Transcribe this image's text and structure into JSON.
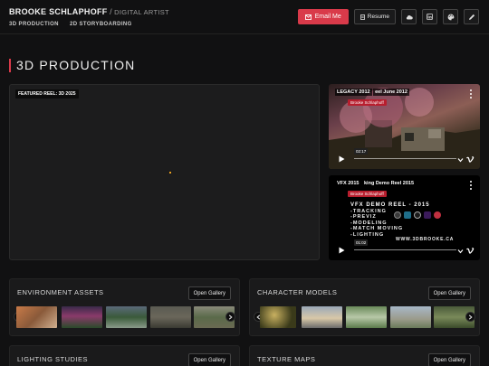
{
  "header": {
    "name": "BROOKE SCHLAPHOFF",
    "separator": "/",
    "role": "DIGITAL ARTIST",
    "nav": [
      "3D PRODUCTION",
      "2D STORYBOARDING"
    ],
    "email_label": "Email Me",
    "resume_label": "Resume",
    "icons": [
      "cloud-icon",
      "linkedin-icon",
      "palette-icon",
      "pencil-icon"
    ]
  },
  "section": {
    "title": "3D PRODUCTION",
    "accent": "#d93a4a"
  },
  "featured": {
    "label": "FEATURED REEL: 3D 2025"
  },
  "videos": [
    {
      "tag": "LEGACY 2012",
      "title": "eel June 2012",
      "byline": "Brooke Schlaphoff",
      "time": "02:17"
    },
    {
      "tag": "VFX 2015",
      "title": "king Demo Reel 2015",
      "byline": "Brooke Schlaphoff",
      "heading": "VFX DEMO REEL - 2015",
      "lines": [
        "-TRACKING",
        "-PREVIZ",
        "-MODELING",
        "-MATCH MOVING",
        "-LIGHTING"
      ],
      "url": "WWW.3DBROOKE.CA",
      "time": "01:02"
    }
  ],
  "galleries": [
    {
      "title": "ENVIRONMENT ASSETS",
      "button": "Open Gallery"
    },
    {
      "title": "CHARACTER MODELS",
      "button": "Open Gallery"
    },
    {
      "title": "LIGHTING STUDIES",
      "button": "Open Gallery"
    },
    {
      "title": "TEXTURE MAPS",
      "button": "Open Gallery"
    }
  ]
}
